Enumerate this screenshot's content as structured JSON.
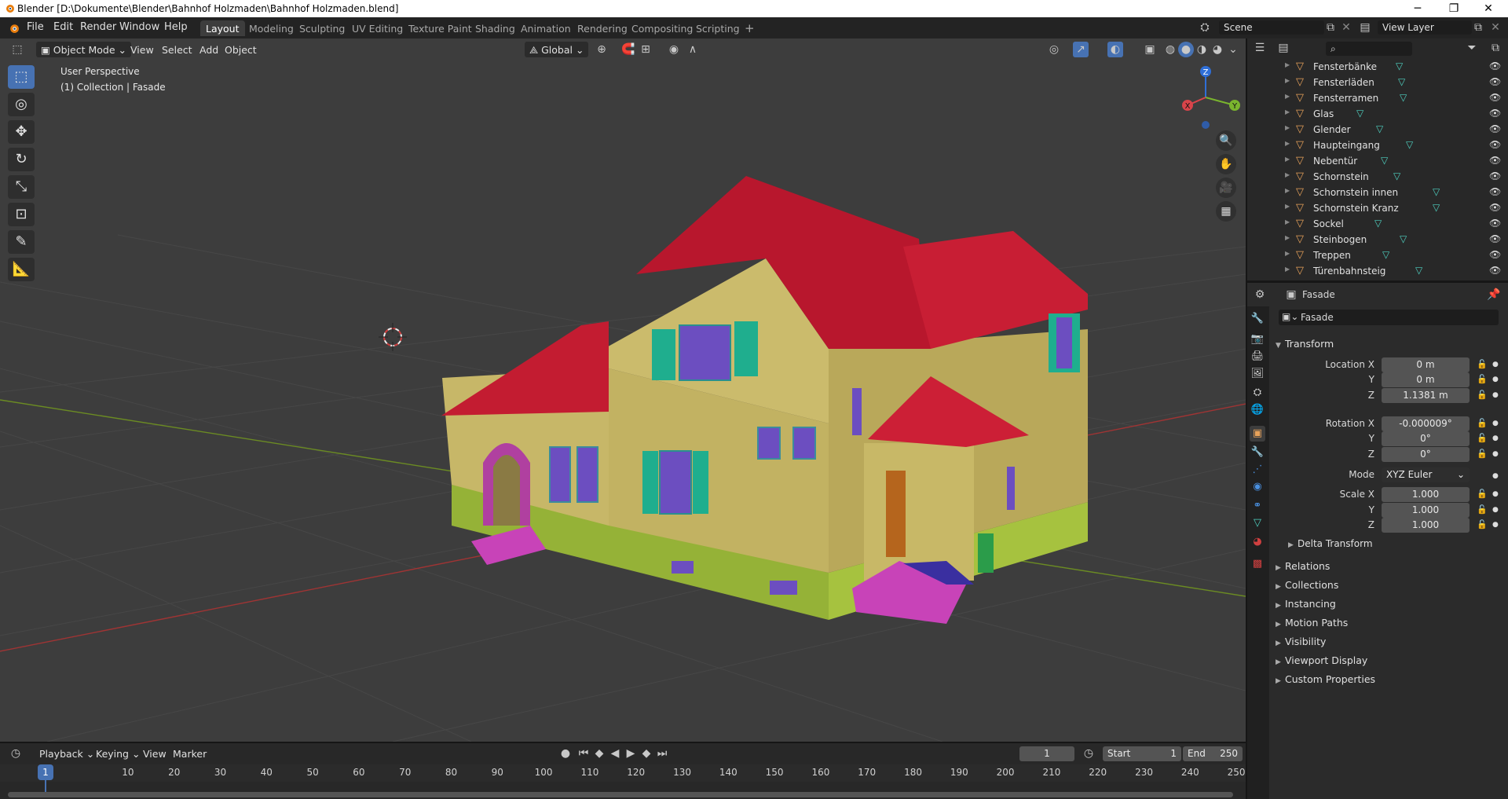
{
  "window": {
    "title": "Blender [D:\\Dokumente\\Blender\\Bahnhof Holzmaden\\Bahnhof Holzmaden.blend]",
    "controls": [
      "─",
      "❐",
      "✕"
    ]
  },
  "menu": {
    "items": [
      "File",
      "Edit",
      "Render",
      "Window",
      "Help"
    ]
  },
  "workspaces": {
    "tabs": [
      "Layout",
      "Modeling",
      "Sculpting",
      "UV Editing",
      "Texture Paint",
      "Shading",
      "Animation",
      "Rendering",
      "Compositing",
      "Scripting"
    ],
    "active": "Layout",
    "add": "+"
  },
  "scene": {
    "name": "Scene",
    "view_layer": "View Layer"
  },
  "viewport_header": {
    "mode": "Object Mode",
    "menus": [
      "View",
      "Select",
      "Add",
      "Object"
    ],
    "orientation": "Global"
  },
  "viewport": {
    "perspective_label": "User Perspective",
    "collection_label": "(1) Collection | Fasade",
    "gizmo_axes": {
      "x": "X",
      "y": "Y",
      "z": "Z"
    },
    "colors": {
      "background": "#3d3d3d",
      "wall": "#c9b96a",
      "roof": "#c81e34",
      "base": "#9ab83a",
      "shutter": "#1fae8e",
      "window": "#6c4ec0",
      "stairs": "#c040b0",
      "door": "#b5651d"
    }
  },
  "outliner": {
    "search_placeholder": "",
    "items": [
      "Fensterbänke",
      "Fensterläden",
      "Fensterramen",
      "Glas",
      "Glender",
      "Haupteingang",
      "Nebentür",
      "Schornstein",
      "Schornstein innen",
      "Schornstein Kranz",
      "Sockel",
      "Steinbogen",
      "Treppen",
      "Türenbahnsteig"
    ]
  },
  "properties": {
    "context_object": "Fasade",
    "object_name": "Fasade",
    "transform_header": "Transform",
    "location": {
      "label_x": "Location X",
      "x": "0 m",
      "y": "0 m",
      "z": "1.1381 m"
    },
    "rotation": {
      "label_x": "Rotation X",
      "x": "-0.000009°",
      "y": "0°",
      "z": "0°"
    },
    "mode": {
      "label": "Mode",
      "value": "XYZ Euler"
    },
    "scale": {
      "label_x": "Scale X",
      "x": "1.000",
      "y": "1.000",
      "z": "1.000"
    },
    "axis_y": "Y",
    "axis_z": "Z",
    "delta_transform": "Delta Transform",
    "panels": [
      "Relations",
      "Collections",
      "Instancing",
      "Motion Paths",
      "Visibility",
      "Viewport Display",
      "Custom Properties"
    ]
  },
  "timeline": {
    "menus": [
      "Playback",
      "Keying",
      "View",
      "Marker"
    ],
    "current_frame": "1",
    "start_label": "Start",
    "start": "1",
    "end_label": "End",
    "end": "250",
    "ticks": [
      "10",
      "20",
      "30",
      "40",
      "50",
      "60",
      "70",
      "80",
      "90",
      "100",
      "110",
      "120",
      "130",
      "140",
      "150",
      "160",
      "170",
      "180",
      "190",
      "200",
      "210",
      "220",
      "230",
      "240",
      "250"
    ],
    "playhead": "1"
  }
}
